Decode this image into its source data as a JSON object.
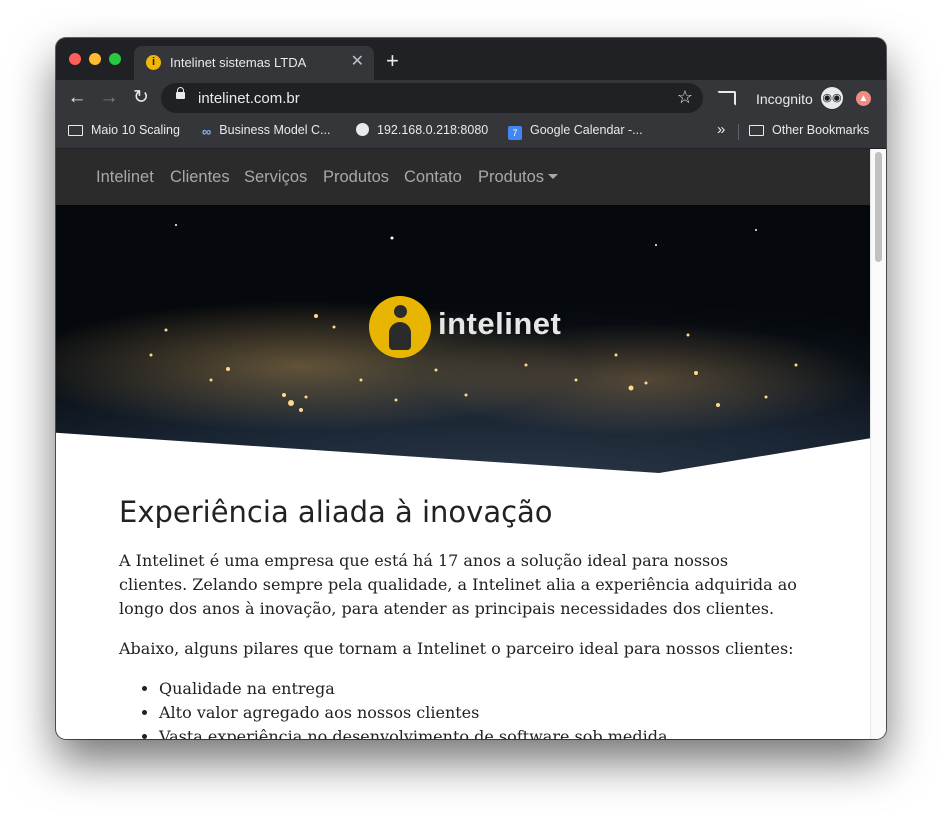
{
  "browser": {
    "tab": {
      "title": "Intelinet sistemas LTDA",
      "favicon": "i"
    },
    "new_tab_label": "+",
    "url": "intelinet.com.br",
    "mode_label": "Incognito",
    "bookmarks": [
      {
        "label": "Maio 10 Scaling",
        "icon": "folder-icon"
      },
      {
        "label": "Business Model C...",
        "icon": "loop-icon"
      },
      {
        "label": "192.168.0.218:8080",
        "icon": "globe-icon"
      },
      {
        "label": "Google Calendar -...",
        "icon": "calendar-icon",
        "badge": "7"
      },
      {
        "label": "Other Bookmarks",
        "icon": "folder-icon"
      }
    ],
    "bookmarks_overflow": "»"
  },
  "site": {
    "nav": [
      "Intelinet",
      "Clientes",
      "Serviços",
      "Produtos",
      "Contato",
      "Produtos"
    ],
    "logo_text": "intelinet",
    "brand_color": "#e8b602",
    "heading": "Experiência aliada à inovação",
    "paragraphs": [
      "A Intelinet é uma empresa que está há 17 anos a solução ideal para nossos clientes. Zelando sempre pela qualidade, a Intelinet alia a experiência adquirida ao longo dos anos à inovação, para atender as principais necessidades dos clientes.",
      "Abaixo, alguns pilares que tornam a Intelinet o parceiro ideal para nossos clientes:"
    ],
    "pillars": [
      "Qualidade na entrega",
      "Alto valor agregado aos nossos clientes",
      "Vasta experiência no desenvolvimento de software sob medida"
    ]
  }
}
